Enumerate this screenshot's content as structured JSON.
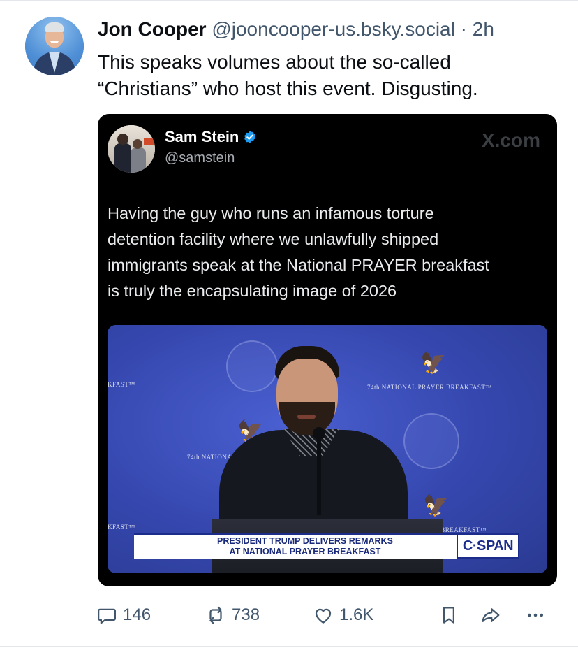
{
  "post": {
    "author_name": "Jon Cooper",
    "handle": "@jooncooper-us.bsky.social",
    "separator": "·",
    "timestamp": "2h",
    "text_line1": "This speaks volumes about the so-called",
    "text_line2": "“Christians” who host this event. Disgusting."
  },
  "embed": {
    "author_name": "Sam Stein",
    "handle": "@samstein",
    "watermark": "X.com",
    "text_lines": [
      "Having the guy who runs an infamous torture",
      "detention facility where we unlawfully shipped",
      "immigrants speak at the National PRAYER breakfast",
      "is truly the encapsulating image of 2026"
    ],
    "media": {
      "backdrop_label_left": "KFAST™",
      "backdrop_label_right": "74th NATIONAL PRAYER BREAKFAST™",
      "backdrop_label_mid": "74th NATIONAL",
      "backdrop_label_bottom_left": "KFAST™",
      "backdrop_label_bottom_right": "R BREAKFAST™",
      "chyron_line1": "PRESIDENT TRUMP DELIVERS REMARKS",
      "chyron_line2": "AT NATIONAL PRAYER BREAKFAST",
      "network_logo": "C·SPAN"
    }
  },
  "actions": {
    "replies": "146",
    "reposts": "738",
    "likes": "1.6K"
  },
  "colors": {
    "muted": "#42576c",
    "embed_bg": "#000000",
    "verified": "#1d9bf0",
    "stage_blue": "#3547ae"
  },
  "icons": [
    "reply-icon",
    "repost-icon",
    "like-icon",
    "bookmark-icon",
    "share-icon",
    "more-icon",
    "verified-icon"
  ]
}
